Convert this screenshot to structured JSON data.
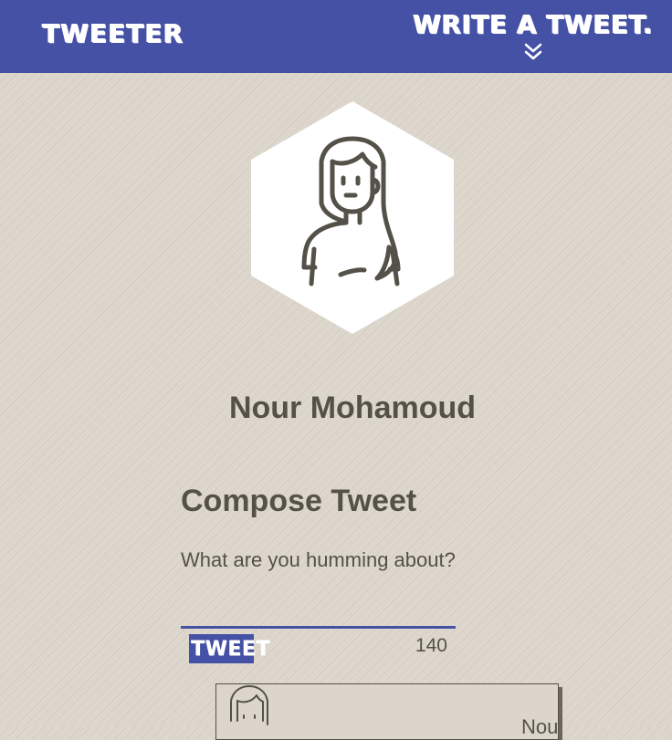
{
  "nav": {
    "brand": "TWEETER",
    "write_label": "WRITE A TWEET.",
    "write_icon": "double-chevron-down-icon"
  },
  "profile": {
    "name": "Nour Mohamoud",
    "avatar_icon": "woman-avatar-icon"
  },
  "compose": {
    "title": "Compose Tweet",
    "placeholder": "What are you humming about?",
    "button_label": "TWEET",
    "counter": "140"
  },
  "tweet_card": {
    "avatar_icon": "woman-avatar-icon",
    "name_partial": "Nou"
  },
  "colors": {
    "accent": "#4451a5",
    "text": "#545149",
    "background": "#dcd5cb"
  }
}
